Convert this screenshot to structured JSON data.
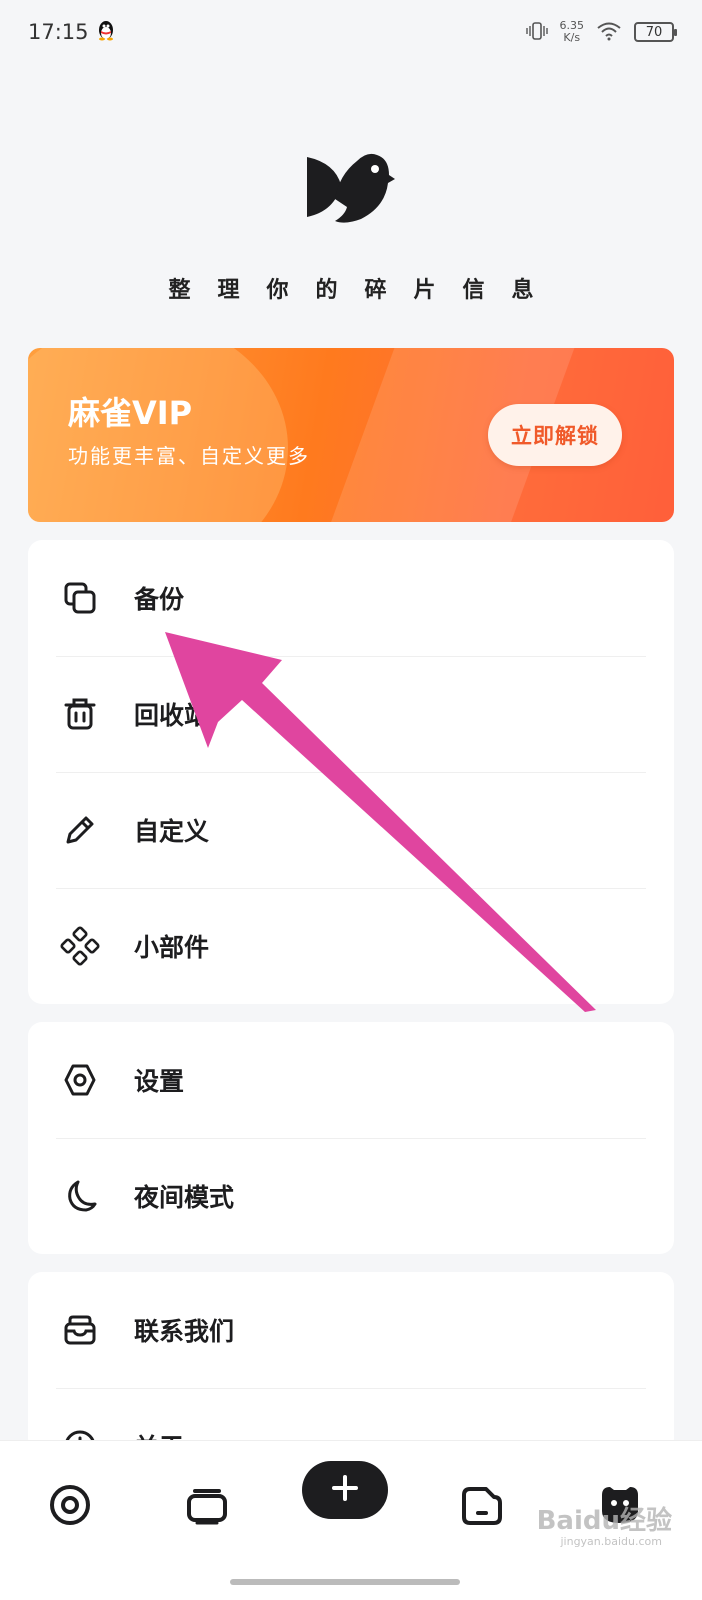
{
  "status_bar": {
    "time": "17:15",
    "net_speed_value": "6.35",
    "net_speed_unit": "K/s",
    "battery": "70"
  },
  "slogan": "整理你的碎片信息",
  "vip": {
    "title": "麻雀VIP",
    "subtitle": "功能更丰富、自定义更多",
    "button": "立即解锁"
  },
  "menu_group_1": [
    {
      "label": "备份",
      "icon": "copy-icon"
    },
    {
      "label": "回收站",
      "icon": "trash-icon"
    },
    {
      "label": "自定义",
      "icon": "pencil-icon"
    },
    {
      "label": "小部件",
      "icon": "widget-icon"
    }
  ],
  "menu_group_2": [
    {
      "label": "设置",
      "icon": "settings-icon"
    },
    {
      "label": "夜间模式",
      "icon": "moon-icon"
    }
  ],
  "menu_group_3": [
    {
      "label": "联系我们",
      "icon": "inbox-icon"
    },
    {
      "label": "关于",
      "icon": "info-icon"
    }
  ],
  "watermark": {
    "text": "Baidu经验",
    "sub": "jingyan.baidu.com"
  },
  "colors": {
    "accent": "#ff7a1e",
    "arrow": "#e0459f",
    "dark": "#1d1d1f"
  }
}
